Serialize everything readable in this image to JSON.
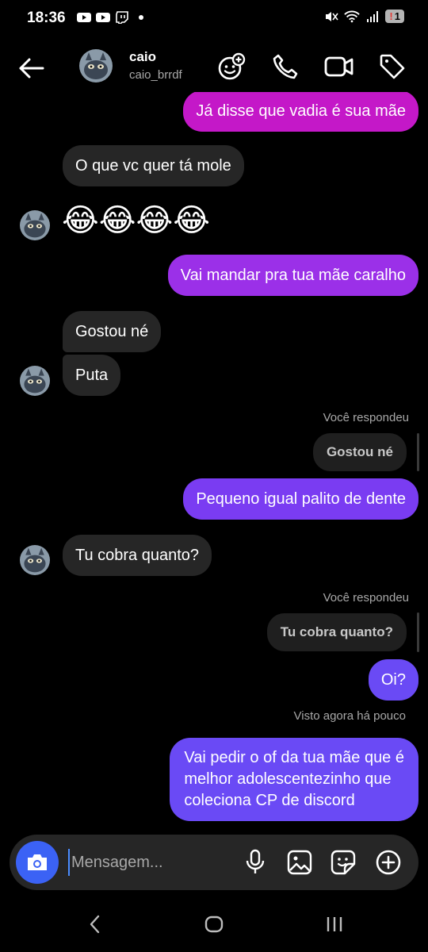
{
  "status": {
    "time": "18:36",
    "battery": "1"
  },
  "header": {
    "name": "caio",
    "username": "caio_brrdf"
  },
  "messages": {
    "m1": "Já disse que vadia é sua mãe",
    "m2": "O que vc quer tá mole",
    "m3": "😂😂😂😂",
    "m4": "Vai mandar pra tua mãe caralho",
    "m5": "Gostou né",
    "m6": "Puta",
    "reply1_label": "Você respondeu",
    "reply1_quote": "Gostou né",
    "m7": "Pequeno igual palito de dente",
    "m8": "Tu cobra quanto?",
    "reply2_label": "Você respondeu",
    "reply2_quote": "Tu cobra quanto?",
    "m9": "Oi?",
    "seen": "Visto agora há pouco",
    "m10_line1": "Vai pedir o of da tua mãe que é",
    "m10_line2": "melhor adolescentezinho que",
    "m10_line3": "coleciona CP de discord"
  },
  "composer": {
    "placeholder": "Mensagem..."
  },
  "colors": {
    "bubble_magenta": "#c418c8",
    "bubble_purple_mid": "#9b30e8",
    "bubble_violet": "#7a3cf2",
    "bubble_blue_violet": "#6a4af5",
    "incoming": "#262626",
    "camera_button": "#3b62f5"
  },
  "icons": {
    "back": "arrow-left-icon",
    "effects": "emoji-plus-icon",
    "call": "phone-icon",
    "video": "video-camera-icon",
    "tag": "tag-icon",
    "camera": "camera-icon",
    "mic": "microphone-icon",
    "gallery": "image-icon",
    "sticker": "sticker-icon",
    "plus": "plus-circle-icon"
  }
}
